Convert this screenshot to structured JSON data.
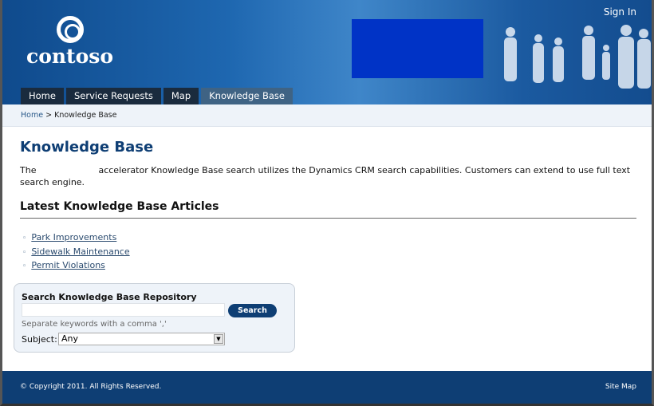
{
  "header": {
    "logo_text": "contoso",
    "sign_in": "Sign In"
  },
  "nav": [
    {
      "label": "Home"
    },
    {
      "label": "Service Requests"
    },
    {
      "label": "Map"
    },
    {
      "label": "Knowledge Base",
      "active": true
    }
  ],
  "breadcrumb": {
    "home": "Home",
    "separator": ">",
    "current": "Knowledge Base"
  },
  "main": {
    "title": "Knowledge Base",
    "intro_start": "The",
    "intro_rest": "accelerator Knowledge Base search utilizes the Dynamics CRM search capabilities. Customers can extend to use full text search engine.",
    "latest_heading": "Latest Knowledge Base Articles",
    "articles": [
      {
        "title": "Park Improvements"
      },
      {
        "title": "Sidewalk Maintenance"
      },
      {
        "title": "Permit Violations"
      }
    ]
  },
  "search": {
    "title": "Search Knowledge Base Repository",
    "input_value": "",
    "button": "Search",
    "hint": "Separate keywords with a comma ','",
    "subject_label": "Subject:",
    "subject_value": "Any"
  },
  "footer": {
    "copyright": "© Copyright 2011. All Rights Reserved.",
    "site_map": "Site Map"
  },
  "colors": {
    "brand": "#0e3e74",
    "redaction": "#0033c6"
  }
}
